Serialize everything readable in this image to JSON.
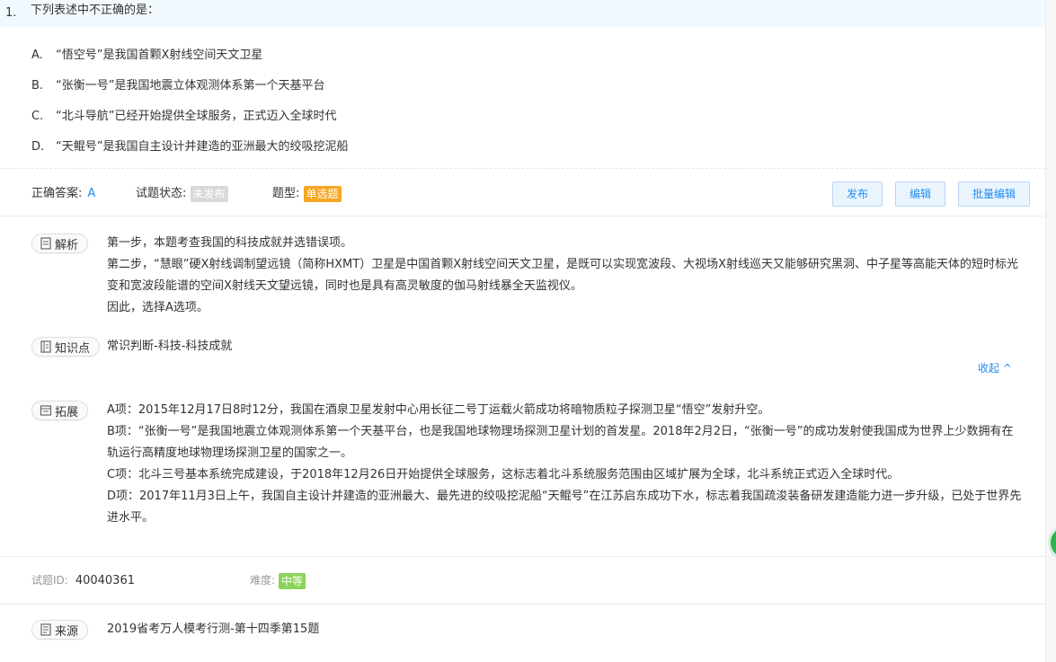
{
  "question": {
    "number": "1.",
    "text": "下列表述中不正确的是：",
    "options": [
      {
        "letter": "A.",
        "text": "“悟空号”是我国首颗X射线空间天文卫星"
      },
      {
        "letter": "B.",
        "text": "“张衡一号”是我国地震立体观测体系第一个天基平台"
      },
      {
        "letter": "C.",
        "text": "“北斗导航”已经开始提供全球服务，正式迈入全球时代"
      },
      {
        "letter": "D.",
        "text": "“天鲲号”是我国自主设计并建造的亚洲最大的绞吸挖泥船"
      }
    ]
  },
  "meta": {
    "answer_label": "正确答案:",
    "answer_value": "A",
    "status_label": "试题状态:",
    "status_value": "未发布",
    "type_label": "题型:",
    "type_value": "单选题"
  },
  "actions": {
    "publish": "发布",
    "edit": "编辑",
    "batch_edit": "批量编辑"
  },
  "analysis": {
    "label": "解析",
    "lines": [
      "第一步，本题考查我国的科技成就并选错误项。",
      "第二步，“慧眼”硬X射线调制望远镜（简称HXMT）卫星是中国首颗X射线空间天文卫星，是既可以实现宽波段、大视场X射线巡天又能够研究黑洞、中子星等高能天体的短时标光变和宽波段能谱的空间X射线天文望远镜，同时也是具有高灵敏度的伽马射线暴全天监视仪。",
      "因此，选择A选项。"
    ]
  },
  "knowledge": {
    "label": "知识点",
    "value": "常识判断-科技-科技成就"
  },
  "collapse_label": "收起 ^",
  "extension": {
    "label": "拓展",
    "lines": [
      "A项：2015年12月17日8时12分，我国在酒泉卫星发射中心用长征二号丁运载火箭成功将暗物质粒子探测卫星“悟空”发射升空。",
      "B项：“张衡一号”是我国地震立体观测体系第一个天基平台，也是我国地球物理场探测卫星计划的首发星。2018年2月2日，“张衡一号”的成功发射使我国成为世界上少数拥有在轨运行高精度地球物理场探测卫星的国家之一。",
      "C项：北斗三号基本系统完成建设，于2018年12月26日开始提供全球服务，这标志着北斗系统服务范围由区域扩展为全球，北斗系统正式迈入全球时代。",
      "D项：2017年11月3日上午，我国自主设计并建造的亚洲最大、最先进的绞吸挖泥船“天鲲号”在江苏启东成功下水，标志着我国疏浚装备研发建造能力进一步升级，已处于世界先进水平。"
    ]
  },
  "footer": {
    "id_label": "试题ID:",
    "id_value": "40040361",
    "difficulty_label": "难度:",
    "difficulty_value": "中等"
  },
  "source": {
    "label": "来源",
    "value": "2019省考万人模考行测-第十四季第15题"
  },
  "colors": {
    "accent": "#1f8ef1",
    "status_badge": "#d9d9d9",
    "type_badge": "#f5a623",
    "difficulty_badge": "#8bd35a"
  }
}
